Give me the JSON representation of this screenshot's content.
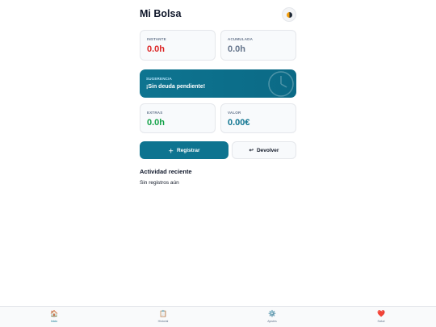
{
  "header": {
    "title": "Mi Bolsa",
    "theme_icon": "half-moon-icon"
  },
  "cards": {
    "instante": {
      "label": "INSTANTE",
      "value": "0.0h",
      "color": "#dc2626"
    },
    "acumulada": {
      "label": "ACUMULADA",
      "value": "0.0h",
      "color": "#64748b"
    },
    "extras": {
      "label": "EXTRAS",
      "value": "0.0h",
      "color": "#16a34a"
    },
    "valor": {
      "label": "VALOR",
      "value": "0.00€",
      "color": "#0e7490"
    }
  },
  "suggestion": {
    "label": "SUGERENCIA",
    "message": "¡Sin deuda pendiente!",
    "icon": "clock-icon"
  },
  "actions": {
    "registrar": {
      "label": "Registrar",
      "icon": "plus-icon"
    },
    "devolver": {
      "label": "Devolver",
      "icon": "return-arrow-icon"
    }
  },
  "activity": {
    "title": "Actividad reciente",
    "empty": "Sin registros aún"
  },
  "nav": [
    {
      "label": "Inicio",
      "icon": "🏠",
      "active": true
    },
    {
      "label": "Historial",
      "icon": "📋",
      "active": false
    },
    {
      "label": "Ajustes",
      "icon": "⚙️",
      "active": false
    },
    {
      "label": "Salud",
      "icon": "❤️",
      "active": false
    }
  ],
  "colors": {
    "accent": "#0e7490"
  }
}
